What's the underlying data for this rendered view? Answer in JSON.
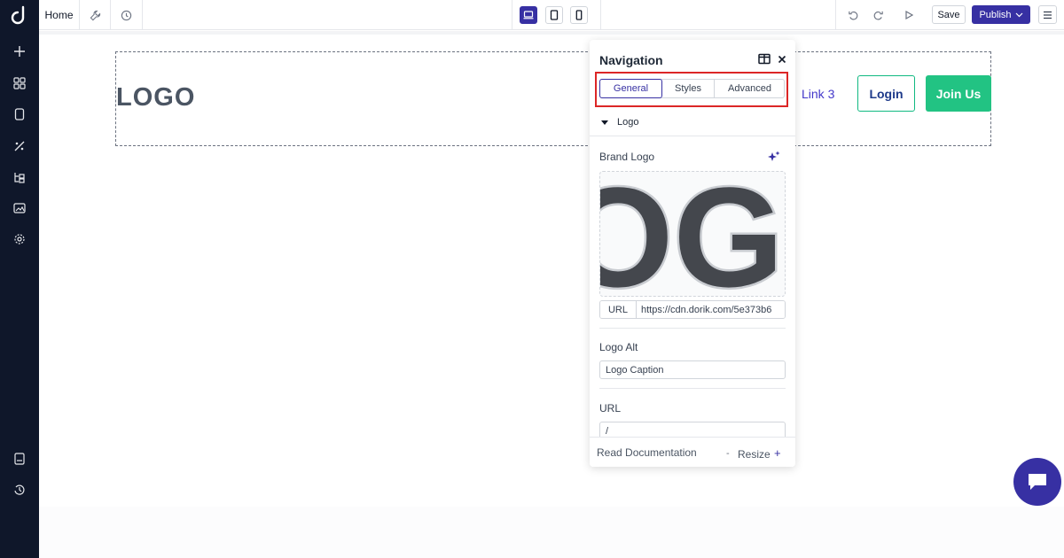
{
  "topbar": {
    "home_label": "Home",
    "wrench_icon": "wrench-icon",
    "history_icon": "clock-icon",
    "devices": [
      "desktop-icon",
      "tablet-icon",
      "mobile-icon"
    ],
    "active_device": "desktop",
    "undo_icon": "undo-icon",
    "redo_icon": "redo-icon",
    "preview_icon": "play-icon",
    "save_label": "Save",
    "publish_label": "Publish",
    "menu_icon": "hamburger-icon"
  },
  "sidebar": {
    "brand_icon": "dorik-logo",
    "top_items": [
      "plus-icon",
      "grid-icon",
      "page-icon",
      "magic-icon",
      "layers-icon",
      "image-icon",
      "settings-icon"
    ],
    "bottom_items": [
      "docs-icon",
      "history-icon"
    ]
  },
  "canvas": {
    "logo_text": "LOGO",
    "link3": "Link 3",
    "login_label": "Login",
    "join_label": "Join Us"
  },
  "panel": {
    "title": "Navigation",
    "tabs": [
      {
        "label": "General",
        "active": true
      },
      {
        "label": "Styles",
        "active": false
      },
      {
        "label": "Advanced",
        "active": false
      }
    ],
    "accordion_label": "Logo",
    "brand_logo_label": "Brand Logo",
    "logo_preview_text": "OG",
    "url_tag": "URL",
    "url_value": "https://cdn.dorik.com/5e373b6",
    "logo_alt_label": "Logo Alt",
    "logo_alt_value": "Logo Caption",
    "url_label": "URL",
    "url_field_value": "/",
    "footer": {
      "read_docs": "Read Documentation",
      "resize_minus": "-",
      "resize_label": "Resize",
      "resize_plus": "+"
    }
  },
  "colors": {
    "accent": "#3730a3",
    "sidebar_bg": "#0f172a",
    "join_green": "#22c383",
    "highlight_red": "#dc2626"
  }
}
